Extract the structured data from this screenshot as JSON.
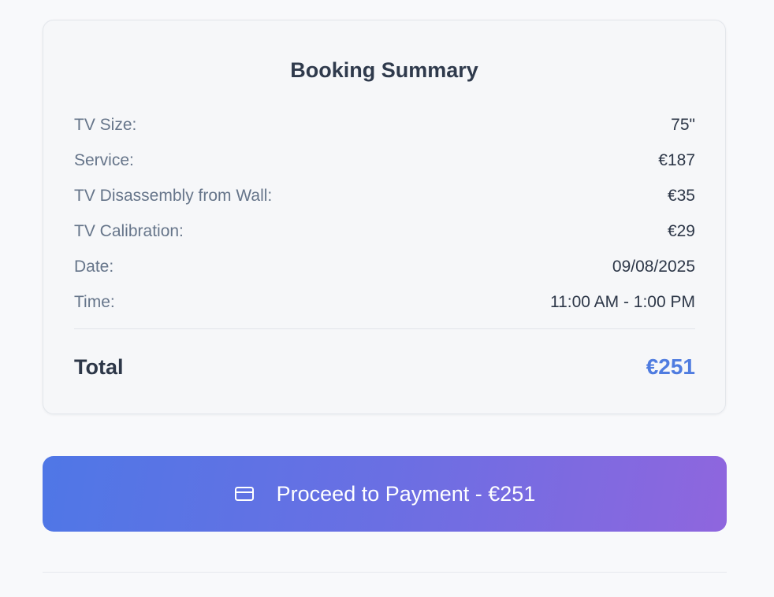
{
  "summary": {
    "title": "Booking Summary",
    "rows": [
      {
        "label": "TV Size:",
        "value": "75\""
      },
      {
        "label": "Service:",
        "value": "€187"
      },
      {
        "label": "TV Disassembly from Wall:",
        "value": "€35"
      },
      {
        "label": "TV Calibration:",
        "value": "€29"
      },
      {
        "label": "Date:",
        "value": "09/08/2025"
      },
      {
        "label": "Time:",
        "value": "11:00 AM - 1:00 PM"
      }
    ],
    "total_label": "Total",
    "total_value": "€251"
  },
  "payment": {
    "button_label": "Proceed to Payment - €251",
    "icon": "credit-card-icon"
  },
  "colors": {
    "accent": "#4f7ce0",
    "button_gradient_start": "#4f77e6",
    "button_gradient_end": "#8f66de"
  }
}
